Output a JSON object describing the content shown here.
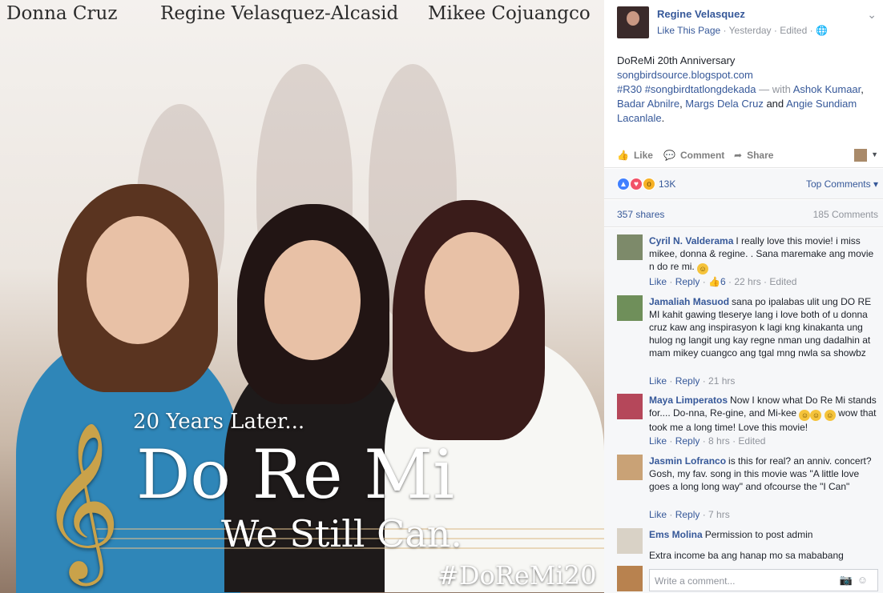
{
  "photo": {
    "names": [
      "Donna Cruz",
      "Regine Velasquez-Alcasid",
      "Mikee Cojuangco"
    ],
    "line1": "20 Years Later...",
    "line2": "Do Re Mi",
    "line3": "We Still Can.",
    "hashtag": "#DoReMi20"
  },
  "post": {
    "page_name": "Regine Velasquez",
    "like_page": "Like This Page",
    "time": "Yesterday",
    "edited": "Edited",
    "title": "DoReMi 20th Anniversary",
    "link": "songbirdsource.blogspot.com",
    "tags": "#R30 #songbirdtatlongdekada",
    "with_text": "— with",
    "people": [
      "Ashok Kumaar",
      "Badar Abnilre",
      "Margs Dela Cruz",
      "Angie Sundiam Lacanlale"
    ],
    "and_text": "and"
  },
  "actions": {
    "like": "Like",
    "comment": "Comment",
    "share": "Share"
  },
  "stats": {
    "reactions": "13K",
    "top_comments": "Top Comments",
    "shares": "357 shares",
    "comments": "185 Comments"
  },
  "comments": [
    {
      "author": "Cyril N. Valderama",
      "text": "I really love this movie! i miss mikee, donna & regine. . Sana maremake ang movie n do re mi.",
      "like": "Like",
      "reply": "Reply",
      "likes": "6",
      "time": "22 hrs",
      "edited": "Edited"
    },
    {
      "author": "Jamaliah Masuod",
      "text": "sana po ipalabas ulit ung DO RE MI kahit gawing tleserye lang i love both of u donna cruz kaw ang inspirasyon k lagi kng kinakanta ung hulog ng langit ung kay regne nman ung dadalhin at mam mikey cuangco ang tgal mng nwla sa showbz",
      "like": "Like",
      "reply": "Reply",
      "time": "21 hrs"
    },
    {
      "author": "Maya Limperatos",
      "text": "Now I know what Do Re Mi stands for.... Do-nna, Re-gine, and Mi-kee",
      "text2": "wow that took me a long time! Love this movie!",
      "like": "Like",
      "reply": "Reply",
      "time": "8 hrs",
      "edited": "Edited"
    },
    {
      "author": "Jasmin Lofranco",
      "text": "is this for real? an anniv. concert? Gosh, my fav. song in this movie was \"A little love goes a long long way\" and ofcourse the \"I Can\"",
      "like": "Like",
      "reply": "Reply",
      "time": "7 hrs"
    },
    {
      "author": "Ems Molina",
      "text": "Permission to post admin",
      "text2": "Extra income ba ang hanap mo sa mababang"
    }
  ],
  "write": {
    "placeholder": "Write a comment..."
  },
  "colors": {
    "link": "#365899",
    "muted": "#90949c",
    "like_blue": "#4080ff",
    "love_red": "#f25268",
    "wow_yellow": "#f7b125"
  }
}
